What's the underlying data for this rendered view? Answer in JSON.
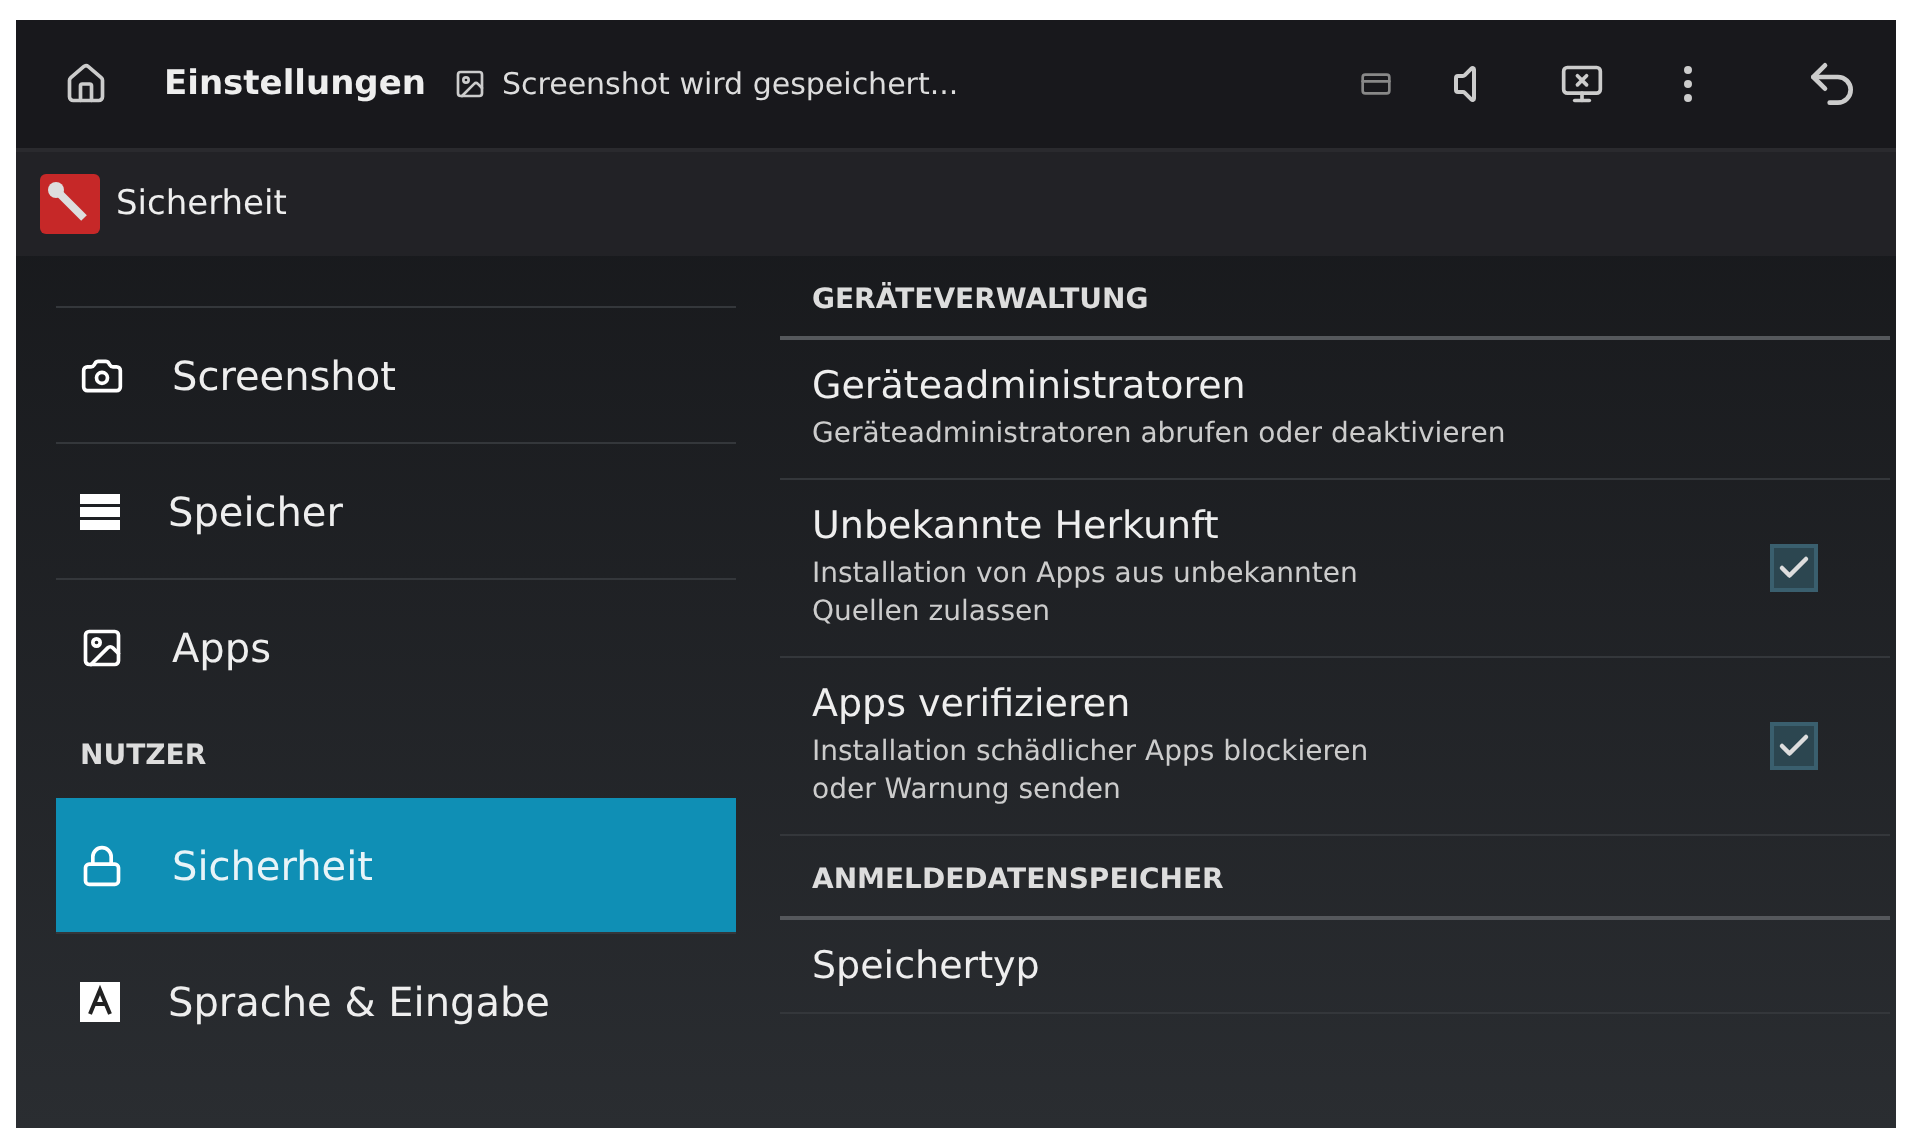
{
  "status_bar": {
    "title": "Einstellungen",
    "notification": "Screenshot wird gespeichert..."
  },
  "action_bar": {
    "title": "Sicherheit"
  },
  "sidebar": {
    "items": [
      {
        "kind": "item",
        "label": "Screenshot",
        "selected": false
      },
      {
        "kind": "item",
        "label": "Speicher",
        "selected": false
      },
      {
        "kind": "item",
        "label": "Apps",
        "selected": false
      },
      {
        "kind": "header",
        "label": "NUTZER"
      },
      {
        "kind": "item",
        "label": "Sicherheit",
        "selected": true
      },
      {
        "kind": "item",
        "label": "Sprache & Eingabe",
        "selected": false
      }
    ]
  },
  "settings": [
    {
      "kind": "header",
      "label": "GERÄTEVERWALTUNG"
    },
    {
      "kind": "item",
      "title": "Geräteadministratoren",
      "summary": "Geräteadministratoren abrufen oder deaktivieren"
    },
    {
      "kind": "check",
      "title": "Unbekannte Herkunft",
      "summary": "Installation von Apps aus unbekannten\nQuellen zulassen",
      "checked": true
    },
    {
      "kind": "check",
      "title": "Apps verifizieren",
      "summary": "Installation schädlicher Apps blockieren\noder Warnung senden",
      "checked": true
    },
    {
      "kind": "header",
      "label": "ANMELDEDATENSPEICHER"
    },
    {
      "kind": "item",
      "title": "Speichertyp"
    }
  ]
}
